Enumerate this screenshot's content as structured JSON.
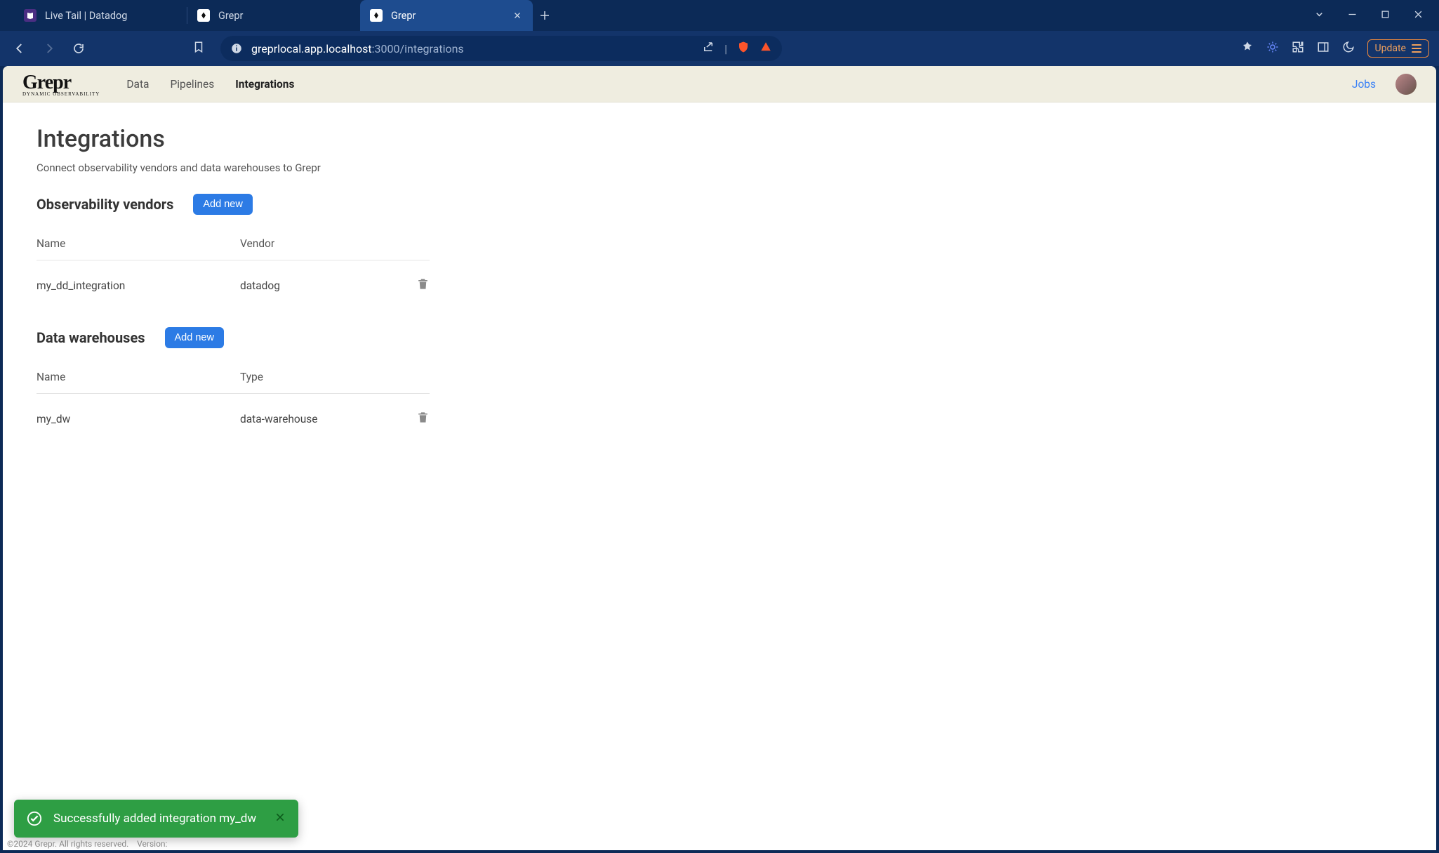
{
  "browser": {
    "tabs": [
      {
        "title": "Live Tail | Datadog",
        "active": false
      },
      {
        "title": "Grepr",
        "active": false
      },
      {
        "title": "Grepr",
        "active": true
      }
    ],
    "url_host": "greprlocal.app.localhost",
    "url_port": ":3000",
    "url_path": "/integrations",
    "update_label": "Update"
  },
  "header": {
    "logo_main": "Grepr",
    "logo_sub": "DYNAMIC OBSERVABILITY",
    "nav": {
      "data": "Data",
      "pipelines": "Pipelines",
      "integrations": "Integrations"
    },
    "jobs": "Jobs"
  },
  "page": {
    "title": "Integrations",
    "desc": "Connect observability vendors and data warehouses to Grepr",
    "vendors": {
      "heading": "Observability vendors",
      "add_label": "Add new",
      "col_name": "Name",
      "col_vendor": "Vendor",
      "rows": [
        {
          "name": "my_dd_integration",
          "vendor": "datadog"
        }
      ]
    },
    "warehouses": {
      "heading": "Data warehouses",
      "add_label": "Add new",
      "col_name": "Name",
      "col_type": "Type",
      "rows": [
        {
          "name": "my_dw",
          "type": "data-warehouse"
        }
      ]
    }
  },
  "toast": {
    "message": "Successfully added integration my_dw"
  },
  "footer": {
    "copyright": "©2024 Grepr. All rights reserved.",
    "version_label": "Version:"
  }
}
